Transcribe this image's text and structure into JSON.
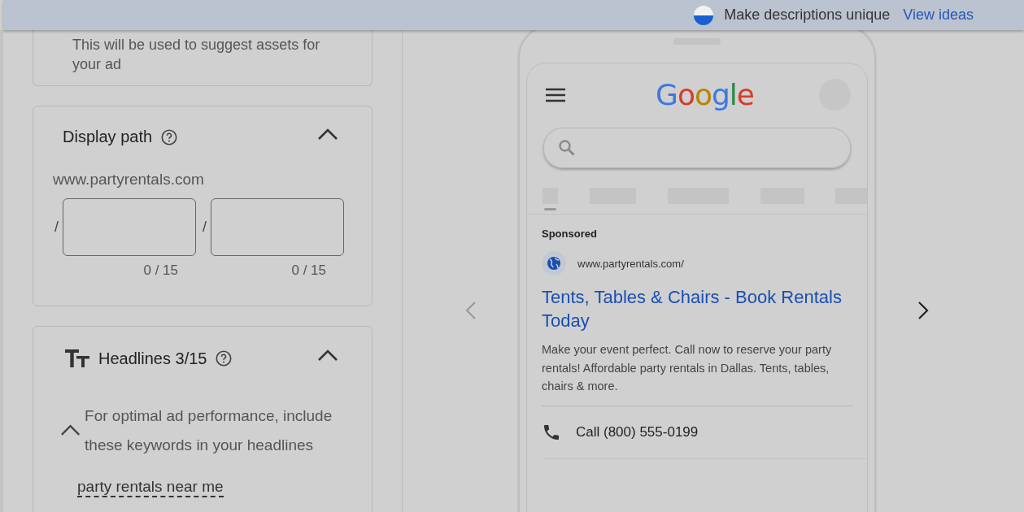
{
  "top_bar": {
    "tip": "Make descriptions unique",
    "link": "View ideas"
  },
  "left_panel": {
    "business_note": "This will be used to suggest assets for your ad",
    "display_path": {
      "title": "Display path",
      "expanded": true,
      "domain": "www.partyrentals.com",
      "separator": "/",
      "fields": [
        {
          "counter": "0 / 15"
        },
        {
          "counter": "0 / 15"
        }
      ]
    },
    "headlines": {
      "title": "Headlines 3/15",
      "expanded": true,
      "keywords_expanded": true,
      "keywords_hint": "For optimal ad performance, include these keywords in your headlines",
      "keywords": [
        "party rentals near me"
      ]
    }
  },
  "preview": {
    "logo": "Google",
    "prev_disabled": true,
    "next_disabled": false,
    "ad": {
      "label": "Sponsored",
      "url": "www.partyrentals.com/",
      "headline": "Tents, Tables & Chairs - Book Rentals Today",
      "description": "Make your event perfect. Call now to reserve your party rentals! Affordable party rentals in Dallas. Tents, tables, chairs & more.",
      "call": "Call (800) 555-0199"
    }
  }
}
